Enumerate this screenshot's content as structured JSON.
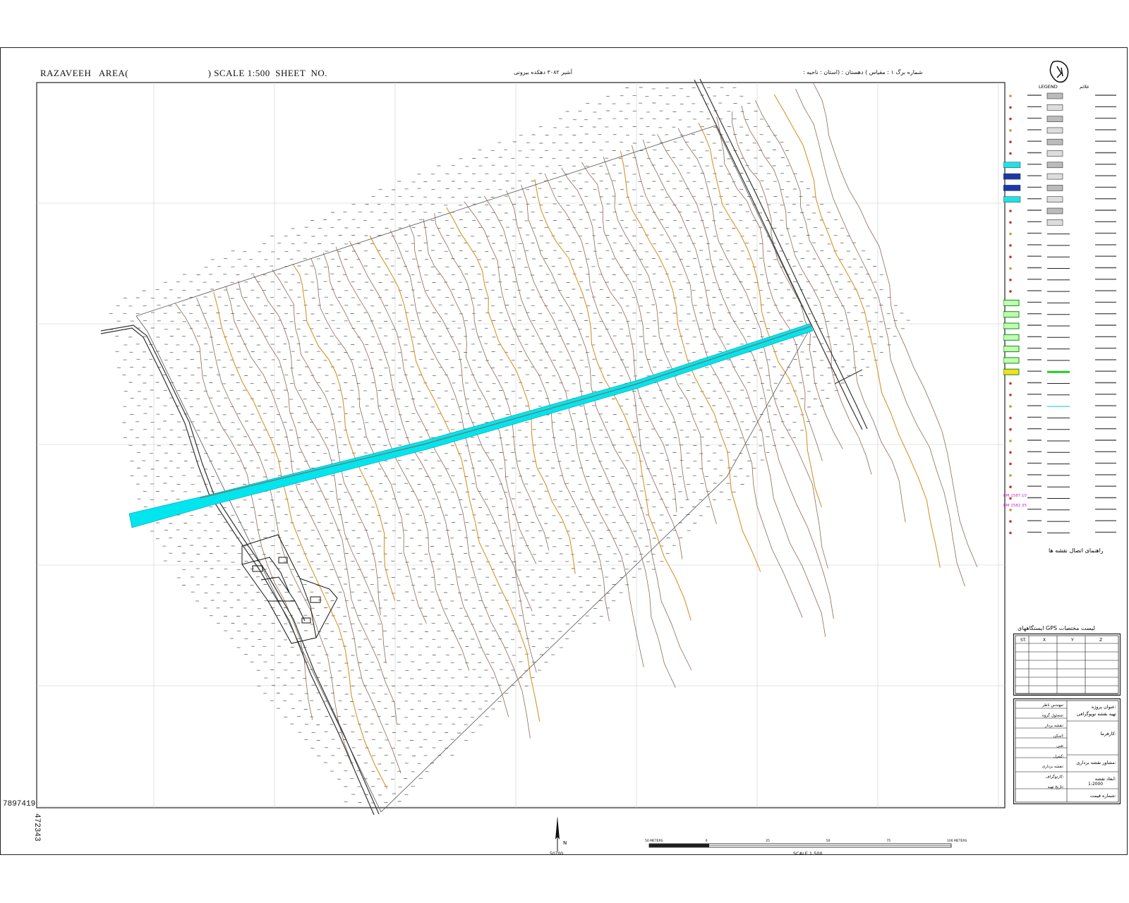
{
  "header": {
    "left": "RAZAVEEH   AREA(                              ) SCALE 1:500  SHEET  NO.",
    "center_fa": "آشیر ۳۰۸۲ دهکده بیرونی",
    "right_fa": ":  شماره برگ       ۱ : مقیاس  )          دهستان :           (استان : ناحیه"
  },
  "map": {
    "contour_color": "#8a6a5a",
    "index_contour_color": "#d4942a",
    "river_color": "#00e5ee",
    "grid_color": "#cccccc",
    "boundary_color": "#555555"
  },
  "coordinates": {
    "northing": "7897419",
    "easting": "472343"
  },
  "legend": {
    "title_en": "LEGEND",
    "title_fa": "علائم",
    "caption_fa": "راهنمای اتصال نقشه ها",
    "bm_labels": [
      "BM\n1587.10",
      "BM\n1582.35"
    ]
  },
  "gps_table": {
    "title_fa": "ایستگاههای GPS       لیست مختصات",
    "headers": [
      "ST.",
      "X",
      "Y",
      "Z"
    ]
  },
  "title_block": {
    "project_label": "عنوان پروژه:",
    "project_value": "تهیه نقشه توپوگرافی",
    "employer_label": "کارفرما:",
    "supervisor_label": "مشاور نقشه برداری:",
    "scale_label": "ابعاد نقشه:",
    "scale_value": "1:2000",
    "date_label": "شماره قیمت:",
    "rows_right": [
      "مهندس ناظر:",
      "مسئول گروه:",
      "نقشه بردار:",
      "اسکن:",
      "فنی:",
      "کنترل:",
      "نقشه برداری:",
      "کارتوگراف:",
      "تاریخ تهیه:"
    ]
  },
  "north_arrow": {
    "label": "N",
    "sub": "50700"
  },
  "scale_bar": {
    "label": "SCALE  1:500",
    "ticks": [
      "50 METERS",
      "0",
      "25",
      "50",
      "75",
      "100 METERS"
    ]
  }
}
